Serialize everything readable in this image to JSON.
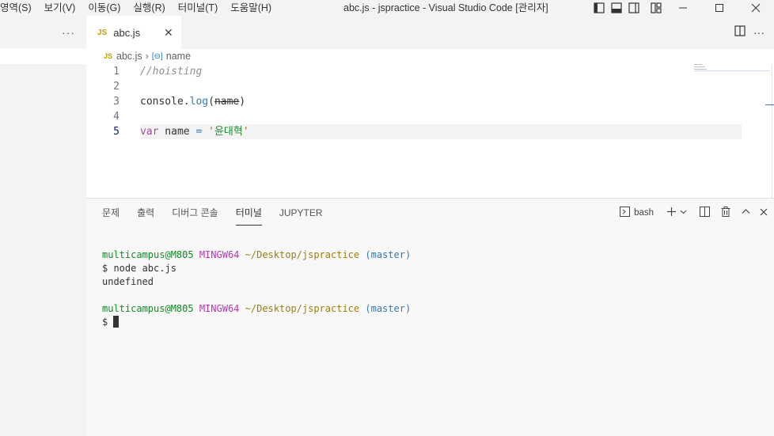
{
  "menubar": {
    "items": [
      "영역(S)",
      "보기(V)",
      "이동(G)",
      "실행(R)",
      "터미널(T)",
      "도움말(H)"
    ]
  },
  "window": {
    "title": "abc.js - jspractice - Visual Studio Code [관리자]"
  },
  "sidebar": {
    "more_label": "···"
  },
  "tabs": [
    {
      "icon": "JS",
      "label": "abc.js",
      "close": "✕"
    }
  ],
  "breadcrumb": {
    "icon": "JS",
    "file": "abc.js",
    "symbol": "name"
  },
  "code": {
    "lines": [
      {
        "number": "1",
        "text": "//hoisting"
      },
      {
        "number": "2",
        "text": ""
      },
      {
        "number": "3",
        "parts": [
          "console",
          ".",
          "log",
          "(",
          "name",
          ")"
        ]
      },
      {
        "number": "4",
        "text": ""
      },
      {
        "number": "5",
        "parts": [
          "var",
          " name ",
          "=",
          " ",
          "'",
          "윤대혁",
          "'"
        ]
      }
    ],
    "current_line": "5"
  },
  "panel": {
    "tabs": [
      "문제",
      "출력",
      "디버그 콘솔",
      "터미널",
      "JUPYTER"
    ],
    "active_tab": "터미널",
    "shell": "bash"
  },
  "terminal": {
    "user": "multicampus@M805",
    "host": "MINGW64",
    "path": "~/Desktop/jspractice",
    "branch": "(master)",
    "command": "$ node abc.js",
    "output": "undefined",
    "prompt": "$ "
  },
  "colors": {
    "accent": "#4a6fd1",
    "js_icon": "#b8a300",
    "term_user": "#0f8a21",
    "term_host": "#b833b8",
    "term_path": "#9a7e0e",
    "term_branch": "#2e7ab8"
  }
}
